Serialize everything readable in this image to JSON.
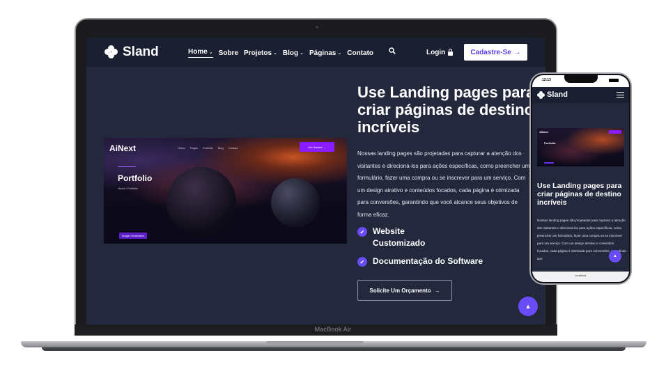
{
  "laptop": {
    "model_label": "MacBook Air",
    "nav": {
      "brand": "Sland",
      "links": [
        {
          "label": "Home",
          "has_caret": true
        },
        {
          "label": "Sobre",
          "has_caret": false
        },
        {
          "label": "Projetos",
          "has_caret": true
        },
        {
          "label": "Blog",
          "has_caret": true
        },
        {
          "label": "Páginas",
          "has_caret": true
        },
        {
          "label": "Contato",
          "has_caret": false
        }
      ],
      "login_label": "Login",
      "signup_label": "Cadastre-Se",
      "signup_arrow": "→",
      "caret": "⌄"
    },
    "hero_card": {
      "brand": "AiNext",
      "menu": [
        "Home",
        "Pages",
        "Portfolio",
        "Blog",
        "Contact"
      ],
      "button": "Get Started →",
      "title": "Portfolio",
      "crumb": "Home / Portfolio",
      "tag": "Image Generation"
    },
    "hero": {
      "title": "Use Landing pages para criar páginas de destino incríveis",
      "description": "Nossas landing pages são projetadas para capturar a atenção dos visitantes e direcioná-los para ações específicas, como preencher um formulário, fazer uma compra ou se inscrever para um serviço. Com um design atrativo e conteúdos focados, cada página é otimizada para conversões, garantindo que você alcance seus objetivos de forma eficaz.",
      "features": [
        "Website Customizado",
        "Documentação do Software"
      ],
      "cta_label": "Solicite Um Orçamento",
      "cta_arrow": "→"
    },
    "scroll_top_icon": "▲"
  },
  "phone": {
    "status_time": "12:13",
    "brand": "Sland",
    "card_brand": "AiNext",
    "card_title": "Portfolio",
    "title": "Use Landing pages para criar páginas de destino incríveis",
    "description": "Nossas landing pages são projetadas para capturar a atenção dos visitantes e direcioná-los para ações específicas, como preencher um formulário, fazer uma compra ou se inscrever para um serviço. Com um design atrativo e conteúdos focados, cada página é otimizada para conversões, garantindo que",
    "url": "localhost",
    "scroll_top_icon": "▲"
  },
  "colors": {
    "accent": "#6a4cf7",
    "bg": "#23283c",
    "nav_bg": "#1a1f31",
    "signup_text": "#5a3ee8"
  }
}
